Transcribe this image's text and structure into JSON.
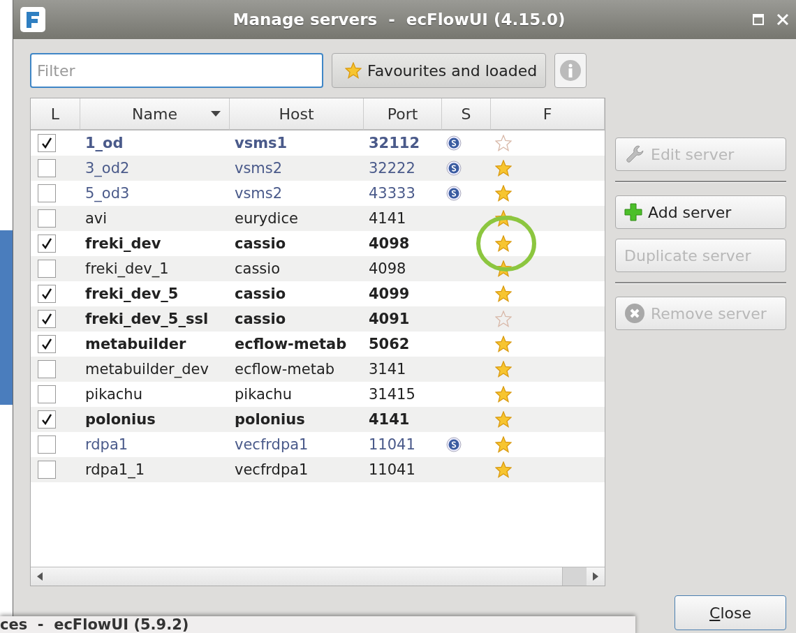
{
  "window": {
    "title": "Manage servers  -  ecFlowUI (4.15.0)"
  },
  "filter": {
    "placeholder": "Filter"
  },
  "favourites_button": {
    "label": "Favourites and loaded"
  },
  "table": {
    "columns": [
      {
        "label": "L",
        "sorted": false
      },
      {
        "label": "Name",
        "sorted": true
      },
      {
        "label": "Host",
        "sorted": false
      },
      {
        "label": "Port",
        "sorted": false
      },
      {
        "label": "S",
        "sorted": false
      },
      {
        "label": "F",
        "sorted": false
      }
    ],
    "rows": [
      {
        "loaded": true,
        "name": "1_od",
        "host": "vsms1",
        "port": "32112",
        "secure": true,
        "favourite": false,
        "highlighted": false
      },
      {
        "loaded": false,
        "name": "3_od2",
        "host": "vsms2",
        "port": "32222",
        "secure": true,
        "favourite": true,
        "highlighted": false
      },
      {
        "loaded": false,
        "name": "5_od3",
        "host": "vsms2",
        "port": "43333",
        "secure": true,
        "favourite": true,
        "highlighted": false
      },
      {
        "loaded": false,
        "name": "avi",
        "host": "eurydice",
        "port": "4141",
        "secure": false,
        "favourite": true,
        "highlighted": false
      },
      {
        "loaded": true,
        "name": "freki_dev",
        "host": "cassio",
        "port": "4098",
        "secure": false,
        "favourite": true,
        "highlighted": true
      },
      {
        "loaded": false,
        "name": "freki_dev_1",
        "host": "cassio",
        "port": "4098",
        "secure": false,
        "favourite": true,
        "highlighted": false
      },
      {
        "loaded": true,
        "name": "freki_dev_5",
        "host": "cassio",
        "port": "4099",
        "secure": false,
        "favourite": true,
        "highlighted": false
      },
      {
        "loaded": true,
        "name": "freki_dev_5_ssl",
        "host": "cassio",
        "port": "4091",
        "secure": false,
        "favourite": false,
        "highlighted": false
      },
      {
        "loaded": true,
        "name": "metabuilder",
        "host": "ecflow-metab",
        "port": "5062",
        "secure": false,
        "favourite": true,
        "highlighted": false
      },
      {
        "loaded": false,
        "name": "metabuilder_dev",
        "host": "ecflow-metab",
        "port": "3141",
        "secure": false,
        "favourite": true,
        "highlighted": false
      },
      {
        "loaded": false,
        "name": "pikachu",
        "host": "pikachu",
        "port": "31415",
        "secure": false,
        "favourite": true,
        "highlighted": false
      },
      {
        "loaded": true,
        "name": "polonius",
        "host": "polonius",
        "port": "4141",
        "secure": false,
        "favourite": true,
        "highlighted": false
      },
      {
        "loaded": false,
        "name": "rdpa1",
        "host": "vecfrdpa1",
        "port": "11041",
        "secure": true,
        "favourite": true,
        "highlighted": false
      },
      {
        "loaded": false,
        "name": "rdpa1_1",
        "host": "vecfrdpa1",
        "port": "11041",
        "secure": false,
        "favourite": true,
        "highlighted": false
      }
    ]
  },
  "actions": [
    {
      "kind": "edit",
      "label": "Edit server",
      "disabled": true,
      "separator_after": true
    },
    {
      "kind": "add",
      "label": "Add server",
      "disabled": false,
      "separator_after": false
    },
    {
      "kind": "plain",
      "label": "Duplicate server",
      "disabled": true,
      "separator_after": true
    },
    {
      "kind": "remove",
      "label": "Remove server",
      "disabled": true,
      "separator_after": false
    }
  ],
  "close_button": {
    "label": "Close"
  },
  "background_window": {
    "title": "ces  -  ecFlowUI (5.9.2)"
  }
}
